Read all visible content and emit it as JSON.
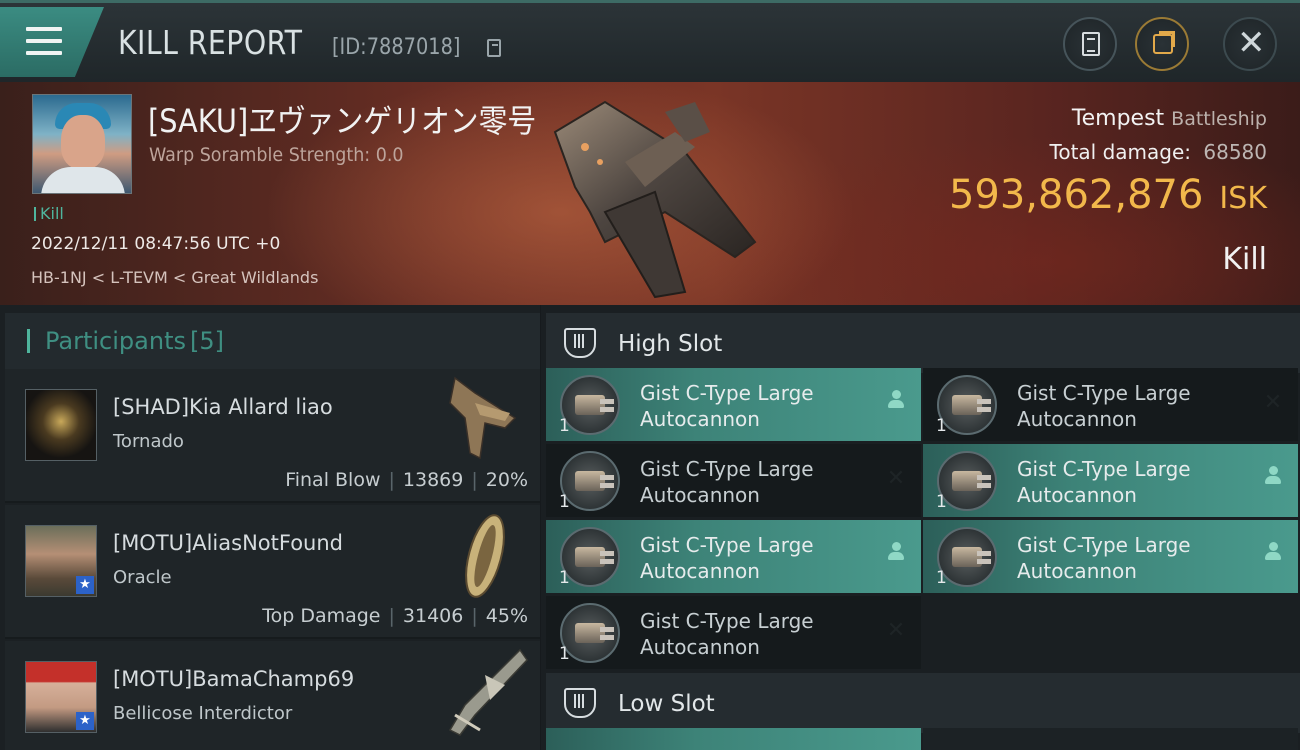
{
  "header": {
    "title": "KILL REPORT",
    "report_id": "[ID:7887018]"
  },
  "victim": {
    "name": "[SAKU]ヱヴァンゲリオン零号",
    "scramble": "Warp Soramble Strength: 0.0",
    "tag": "Kill",
    "time": "2022/12/11 08:47:56 UTC +0",
    "location": "HB-1NJ < L-TEVM < Great Wildlands",
    "ship_name": "Tempest",
    "ship_class": "Battleship",
    "total_damage_label": "Total damage:",
    "total_damage": "68580",
    "isk_value": "593,862,876",
    "isk_unit": "ISK",
    "result": "Kill"
  },
  "participants": {
    "label": "Participants",
    "count": "[5]",
    "items": [
      {
        "name": "[SHAD]Kia Allard liao",
        "ship": "Tornado",
        "role": "Final Blow",
        "damage": "13869",
        "percent": "20%"
      },
      {
        "name": "[MOTU]AliasNotFound",
        "ship": "Oracle",
        "role": "Top Damage",
        "damage": "31406",
        "percent": "45%"
      },
      {
        "name": "[MOTU]BamaChamp69",
        "ship": "Bellicose Interdictor",
        "role": "",
        "damage": "",
        "percent": ""
      }
    ]
  },
  "slots": {
    "high_label": "High Slot",
    "low_label": "Low Slot",
    "high_modules": [
      {
        "name": "Gist C-Type Large Autocannon",
        "qty": "1",
        "state": "on",
        "status_icon": "person-icon"
      },
      {
        "name": "Gist C-Type Large Autocannon",
        "qty": "1",
        "state": "off",
        "status_icon": "x-icon"
      },
      {
        "name": "Gist C-Type Large Autocannon",
        "qty": "1",
        "state": "off",
        "status_icon": "x-icon"
      },
      {
        "name": "Gist C-Type Large Autocannon",
        "qty": "1",
        "state": "on",
        "status_icon": "person-icon"
      },
      {
        "name": "Gist C-Type Large Autocannon",
        "qty": "1",
        "state": "on",
        "status_icon": "person-icon"
      },
      {
        "name": "Gist C-Type Large Autocannon",
        "qty": "1",
        "state": "on",
        "status_icon": "person-icon"
      },
      {
        "name": "Gist C-Type Large Autocannon",
        "qty": "1",
        "state": "off",
        "status_icon": "x-icon"
      }
    ]
  },
  "colors": {
    "accent": "#4fb59d",
    "isk": "#f2b84b",
    "module_on": "#3d8378",
    "module_off": "#151a1c"
  }
}
